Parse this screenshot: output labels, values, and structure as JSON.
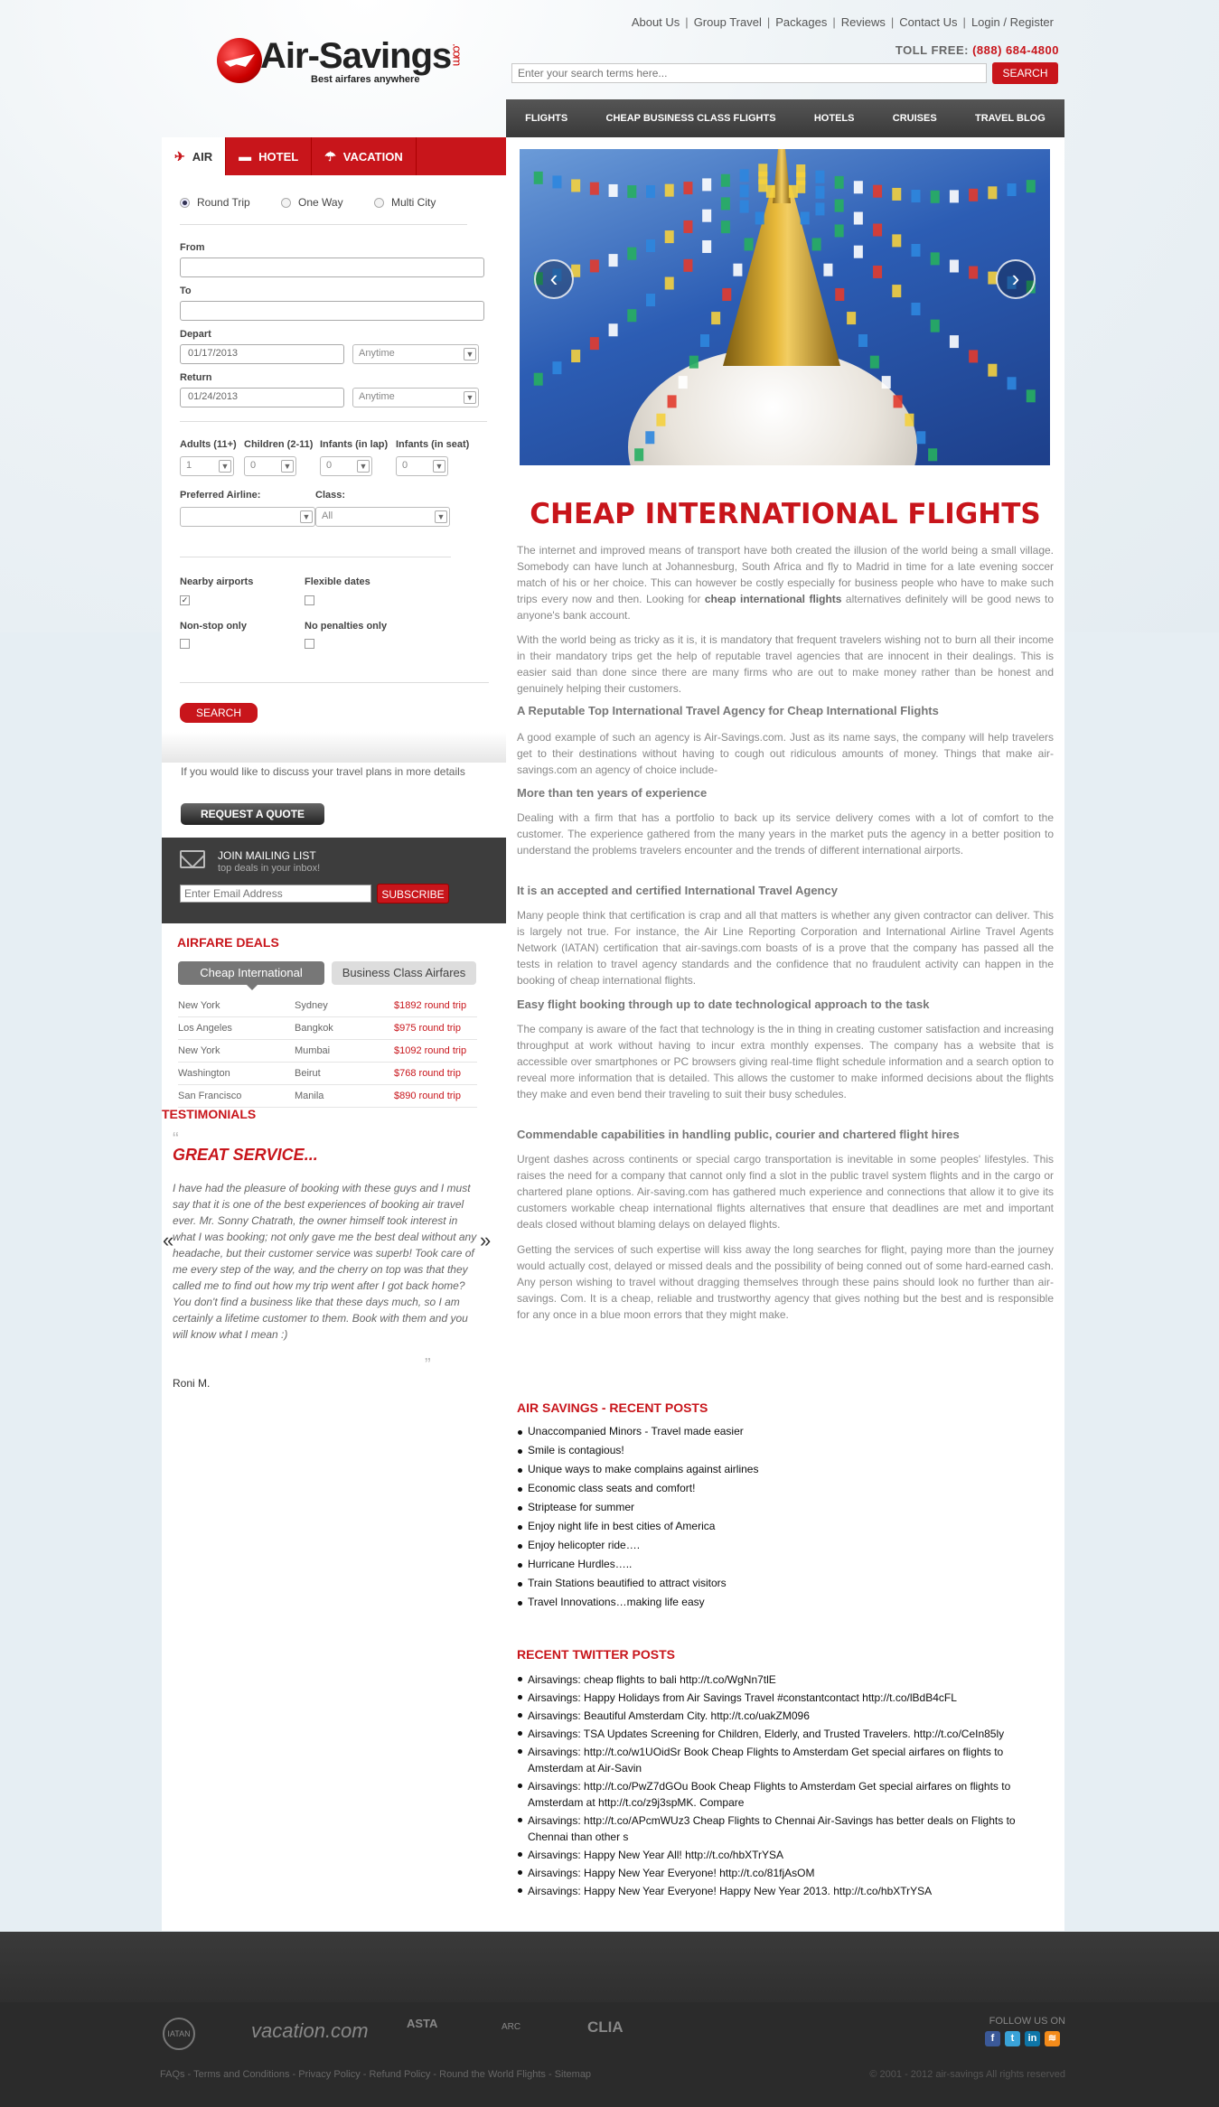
{
  "header": {
    "top_links": [
      "About Us",
      "Group Travel",
      "Packages",
      "Reviews",
      "Contact Us",
      "Login / Register"
    ],
    "logo_name": "Air-Savings",
    "logo_com": ".com",
    "logo_tagline": "Best airfares anywhere",
    "tollfree_label": "TOLL FREE:",
    "tollfree_number": "(888) 684-4800",
    "search_placeholder": "Enter your search terms here...",
    "search_button": "SEARCH"
  },
  "nav": [
    "FLIGHTS",
    "CHEAP BUSINESS CLASS FLIGHTS",
    "HOTELS",
    "CRUISES",
    "TRAVEL BLOG"
  ],
  "booking": {
    "tabs": [
      {
        "label": "AIR",
        "icon": "plane-icon"
      },
      {
        "label": "HOTEL",
        "icon": "bed-icon"
      },
      {
        "label": "VACATION",
        "icon": "palm-tree-icon"
      }
    ],
    "trip_types": [
      "Round Trip",
      "One Way",
      "Multi City"
    ],
    "from_label": "From",
    "to_label": "To",
    "depart_label": "Depart",
    "depart_date": "01/17/2013",
    "depart_time": "Anytime",
    "return_label": "Return",
    "return_date": "01/24/2013",
    "return_time": "Anytime",
    "adults_label": "Adults (11+)",
    "adults_value": "1",
    "children_label": "Children (2-11)",
    "children_value": "0",
    "infants_lap_label": "Infants (in lap)",
    "infants_lap_value": "0",
    "infants_seat_label": "Infants (in seat)",
    "infants_seat_value": "0",
    "airline_label": "Preferred Airline:",
    "airline_value": "",
    "class_label": "Class:",
    "class_value": "All",
    "nearby_label": "Nearby airports",
    "flexible_label": "Flexible dates",
    "nonstop_label": "Non-stop only",
    "nopenalty_label": "No penalties only",
    "search_button": "SEARCH"
  },
  "quote": {
    "text": "If you would like to discuss your travel plans in more details",
    "button": "REQUEST A QUOTE"
  },
  "mailing": {
    "title": "JOIN MAILING LIST",
    "subtitle": "top deals in your inbox!",
    "placeholder": "Enter Email Address",
    "button": "SUBSCRIBE"
  },
  "deals": {
    "title": "AIRFARE DEALS",
    "tabs": [
      "Cheap International",
      "Business Class Airfares"
    ],
    "rows": [
      {
        "from": "New York",
        "to": "Sydney",
        "price": "$1892 round trip"
      },
      {
        "from": "Los Angeles",
        "to": "Bangkok",
        "price": "$975 round trip"
      },
      {
        "from": "New York",
        "to": "Mumbai",
        "price": "$1092 round trip"
      },
      {
        "from": "Washington",
        "to": "Beirut",
        "price": "$768 round trip"
      },
      {
        "from": "San Francisco",
        "to": "Manila",
        "price": "$890 round trip"
      }
    ]
  },
  "testimonials": {
    "title": "TESTIMONIALS",
    "headline": "GREAT SERVICE...",
    "body": "I have had the pleasure of booking with these guys and I must say that it is one of the best experiences of booking air travel ever. Mr. Sonny Chatrath, the owner himself took interest in what I was booking; not only gave me the best deal without any headache, but their customer service was superb! Took care of me every step of the way, and the cherry on top was that they called me to find out how my trip went after I got back home? You don't find a business like that these days much, so I am certainly a lifetime customer to them. Book with them and you will know what I mean :)",
    "author": "Roni M."
  },
  "article": {
    "title": "CHEAP INTERNATIONAL FLIGHTS",
    "p1_a": "The internet and improved means of transport have both created the illusion of the world being a small village. Somebody can have lunch at Johannesburg, South Africa and fly to Madrid in time for a late evening soccer match of his or her choice. This can however be costly especially for business people who have to make such trips every now and then. Looking for ",
    "p1_bold": "cheap international flights",
    "p1_b": " alternatives definitely will be good news to anyone's bank account.",
    "p2": "With the world being as tricky as it is, it is mandatory that frequent travelers wishing not to burn all their income in their mandatory trips get the help of reputable travel agencies that are innocent in their dealings. This is easier said than done since there are many firms who are out to make money rather than be honest and genuinely helping their customers.",
    "h1": "A Reputable Top International Travel Agency for Cheap International Flights",
    "p3": "A good example of such an agency is Air-Savings.com. Just as its name says, the company will help travelers get to their destinations without having to cough out ridiculous amounts of money. Things that make air-savings.com an agency of choice include-",
    "h2": "More than ten years of experience",
    "p4": "Dealing with a firm that has a portfolio to back up its service delivery comes with a lot of comfort to the customer. The experience gathered from the many years in the market puts the agency in a better position to understand the problems travelers encounter and the trends of different international airports.",
    "h3": "It is an accepted and certified International Travel Agency",
    "p5": "Many people think that certification is crap and all that matters is whether any given contractor can deliver. This is largely not true. For instance, the Air Line Reporting Corporation and International Airline Travel Agents Network (IATAN) certification that  air-savings.com boasts of is a prove that the company has passed all the tests in relation to travel agency standards and the confidence that no fraudulent activity can happen in the booking of cheap international flights.",
    "h4": "Easy flight booking through up to date technological approach to the task",
    "p6": "The company is aware of the fact that technology is the in thing in creating customer satisfaction and increasing throughput at work without having to incur extra monthly expenses. The company has a website that is accessible over smartphones or PC browsers giving real-time flight schedule information and a search option to reveal more information that is detailed. This allows the customer to make informed decisions about the flights they make and even bend their traveling to suit their busy schedules.",
    "h5": "Commendable capabilities in handling public, courier and chartered flight hires",
    "p7": "Urgent dashes across continents or special cargo transportation is inevitable in some peoples' lifestyles. This raises the need for a company that cannot only find a slot in the public travel system flights and in the cargo or chartered plane options. Air-saving.com has gathered much experience and connections that allow it to give its customers workable cheap international flights alternatives that ensure that deadlines are met and important deals closed without blaming delays on delayed flights.",
    "p8": "Getting the services of such expertise will kiss away the long searches for flight, paying more than the journey would actually cost, delayed or missed deals and the possibility of being conned out of some hard-earned cash. Any person wishing to travel without dragging themselves through these pains should look no further than air-savings. Com. It is a cheap, reliable and trustworthy agency that gives nothing but the best and is responsible for any once in a blue moon errors that they might make."
  },
  "recent_posts": {
    "title": "AIR SAVINGS - RECENT POSTS",
    "items": [
      "Unaccompanied Minors - Travel made easier",
      "Smile is contagious!",
      "Unique ways to make complains against airlines",
      "Economic class seats and comfort!",
      "Striptease for summer",
      "Enjoy night life in best cities of America",
      "Enjoy helicopter ride….",
      "Hurricane Hurdles…..",
      "Train Stations beautified to attract visitors",
      "Travel Innovations…making life easy"
    ]
  },
  "twitter": {
    "title": "RECENT TWITTER POSTS",
    "items": [
      "Airsavings: cheap flights to bali http://t.co/WgNn7tlE",
      "Airsavings: Happy Holidays from Air Savings Travel #constantcontact http://t.co/lBdB4cFL",
      "Airsavings: Beautiful Amsterdam City. http://t.co/uakZM096",
      "Airsavings: TSA Updates Screening for Children, Elderly, and Trusted Travelers. http://t.co/CeIn85ly",
      "Airsavings: http://t.co/w1UOidSr Book Cheap Flights to Amsterdam Get special airfares on flights to Amsterdam at Air-Savin",
      "Airsavings: http://t.co/PwZ7dGOu Book Cheap Flights to Amsterdam Get special airfares on flights to Amsterdam at http://t.co/z9j3spMK. Compare",
      "Airsavings: http://t.co/APcmWUz3 Cheap Flights to Chennai Air-Savings has better deals on Flights to Chennai than other s",
      "Airsavings: Happy New Year All! http://t.co/hbXTrYSA",
      "Airsavings: Happy New Year Everyone! http://t.co/81fjAsOM",
      "Airsavings: Happy New Year Everyone! Happy New Year 2013. http://t.co/hbXTrYSA"
    ]
  },
  "footer": {
    "logos": [
      "IATAN",
      "vacation.com",
      "ASTA",
      "ARC",
      "CLIA"
    ],
    "follow_label": "FOLLOW US ON",
    "links": "FAQs - Terms and Conditions - Privacy Policy - Refund Policy - Round the World Flights - Sitemap",
    "copyright": "© 2001 - 2012 air-savings All rights reserved"
  },
  "colors": {
    "brand_red": "#c8151b",
    "nav_dark": "#3a3a3a",
    "footer_bg": "#2b2b2b"
  }
}
